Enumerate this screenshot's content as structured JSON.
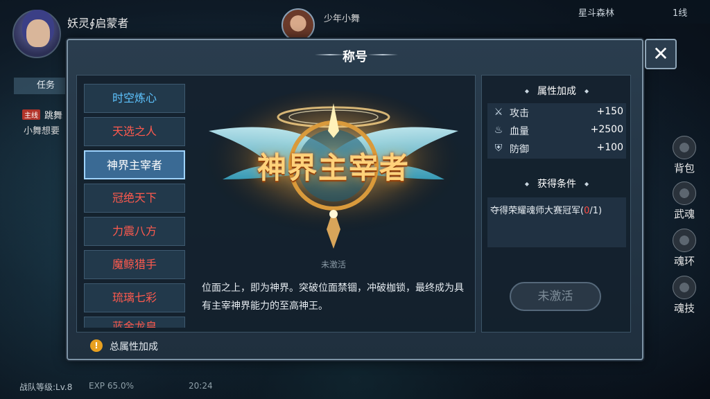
{
  "hud": {
    "player_name": "妖灵∮启蒙者",
    "task_tab": "任务",
    "quest_tag": "主线",
    "quest_title": "跳舞",
    "quest_desc": "小舞想要",
    "partner_name": "少年小舞",
    "map_name": "星斗森林",
    "map_line": "1线",
    "side_buttons": [
      "背包",
      "武魂",
      "魂环",
      "魂技"
    ],
    "level_text": "战队等级:Lv.8",
    "exp_text": "EXP 65.0%",
    "time_text": "20:24"
  },
  "modal": {
    "title": "称号",
    "close_label": "✕",
    "titles": [
      {
        "label": "时空炼心",
        "color": "blue"
      },
      {
        "label": "天选之人",
        "color": "red"
      },
      {
        "label": "神界主宰者",
        "color": "white",
        "selected": true
      },
      {
        "label": "冠绝天下",
        "color": "red"
      },
      {
        "label": "力震八方",
        "color": "red"
      },
      {
        "label": "魔鲸猎手",
        "color": "red"
      },
      {
        "label": "琉璃七彩",
        "color": "red"
      },
      {
        "label": "蓝金龙皇",
        "color": "red"
      }
    ],
    "emblem_text": "神界主宰者",
    "status": "未激活",
    "description": "位面之上，即为神界。突破位面禁锢，冲破枷锁，最终成为具有主宰神界能力的至高神王。",
    "attr_header": "属性加成",
    "attributes": [
      {
        "icon": "sword-icon",
        "name": "攻击",
        "value": "+150"
      },
      {
        "icon": "potion-icon",
        "name": "血量",
        "value": "+2500"
      },
      {
        "icon": "shield-icon",
        "name": "防御",
        "value": "+100"
      }
    ],
    "cond_header": "获得条件",
    "condition_text": "夺得荣耀魂师大赛冠军(",
    "condition_progress": "0",
    "condition_suffix": "/1)",
    "activate_label": "未激活",
    "footer_label": "总属性加成",
    "footer_icon": "!"
  }
}
